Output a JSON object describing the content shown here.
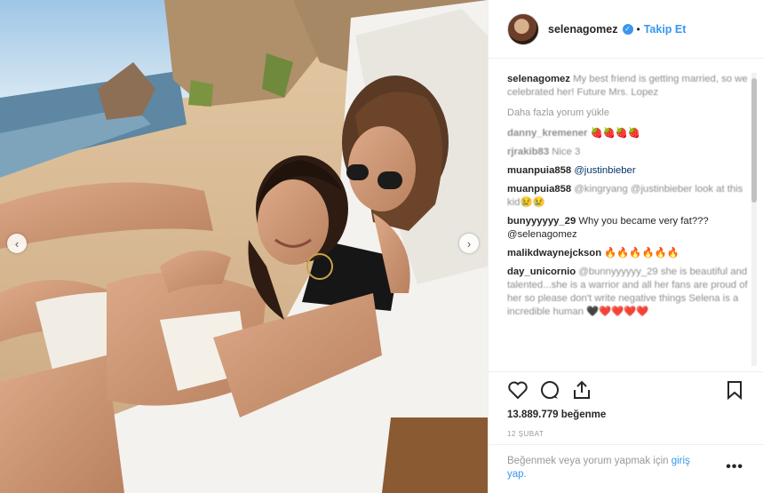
{
  "post": {
    "username": "selenagomez",
    "follow_label": "Takip Et",
    "dot": "•",
    "caption_user": "selenagomez",
    "caption_text": "My best friend is getting married, so we celebrated her! Future Mrs. Lopez",
    "load_more": "Daha fazla yorum yükle",
    "comments": [
      {
        "user": "danny_kremener",
        "text": "🍓🍓🍓🍓"
      },
      {
        "user": "rjrakib83",
        "text": "Nice 3"
      },
      {
        "user": "muanpuia858",
        "text": "@justinbieber"
      },
      {
        "user": "muanpuia858",
        "text": "@kingryang @justinbieber look at this kid😢😢"
      },
      {
        "user": "bunyyyyyy_29",
        "text": "Why you became very fat??? @selenagomez"
      },
      {
        "user": "malikdwaynejckson",
        "text": "🔥🔥🔥🔥🔥🔥"
      },
      {
        "user": "day_unicornio",
        "text": "@bunnyyyyyy_29 she is beautiful and talented...she is a warrior and all her fans are proud of her so please don't write negative things Selena is a incredible human 🖤❤️❤️❤️❤️"
      }
    ],
    "likes": "13.889.779 beğenme",
    "date": "12 ŞUBAT",
    "footer_text": "Beğenmek veya yorum yapmak için",
    "footer_login": "giriş yap.",
    "more": "•••",
    "carousel_prev": "‹",
    "carousel_next": "›"
  },
  "colors": {
    "accent": "#3897f0",
    "text": "#262626",
    "muted": "#8e8e8e"
  }
}
